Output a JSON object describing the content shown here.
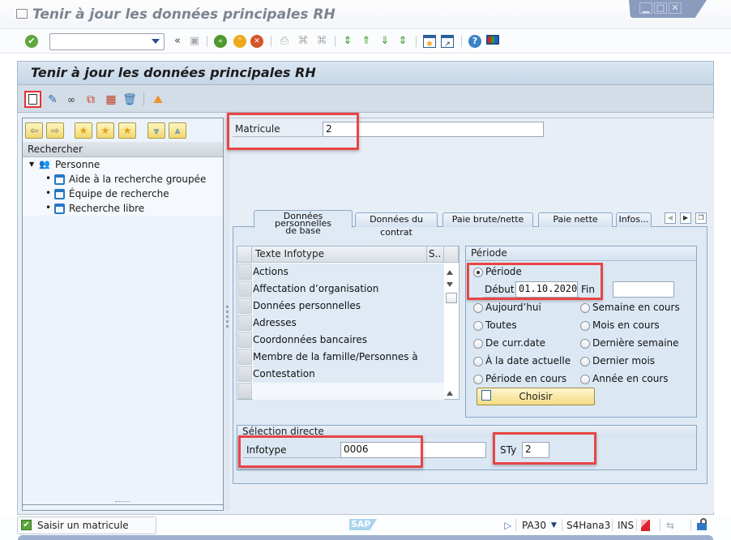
{
  "window": {
    "title": "Tenir à jour les données principales RH",
    "controls": {
      "minimize": "▁",
      "maximize": "□",
      "close": "✕"
    }
  },
  "toolbar": {
    "command_field_value": "",
    "icons": [
      "enter-icon",
      "back-arrows-icon",
      "save-icon",
      "back-icon",
      "exit-icon",
      "cancel-icon",
      "print-icon",
      "find-icon",
      "find-next-icon",
      "first-page-icon",
      "previous-page-icon",
      "next-page-icon",
      "last-page-icon",
      "create-session-icon",
      "shortcut-icon",
      "help-icon",
      "customize-layout-icon"
    ]
  },
  "header": {
    "title": "Tenir à jour les données principales RH"
  },
  "app_toolbar": {
    "icons": [
      "create-icon",
      "change-icon",
      "display-icon",
      "copy-icon",
      "overview-icon",
      "delete-icon",
      "picture-icon"
    ]
  },
  "nav_panel": {
    "search_header": "Rechercher",
    "tree": {
      "root": "Personne",
      "children": [
        "Aide à la recherche groupée",
        "Équipe de recherche",
        "Recherche libre"
      ]
    }
  },
  "matricule": {
    "label": "Matricule",
    "value": "2"
  },
  "tabs": [
    {
      "label": "Données personnelles de base",
      "line1": "Données personnelles",
      "line2": "de base",
      "active": true
    },
    {
      "label": "Données du contrat",
      "active": false
    },
    {
      "label": "Paie brute/nette",
      "active": false
    },
    {
      "label": "Paie nette",
      "active": false
    },
    {
      "label": "Infos...",
      "active": false
    }
  ],
  "infotype_table": {
    "columns": [
      "Texte Infotype",
      "S.."
    ],
    "rows": [
      "Actions",
      "Affectation d’organisation",
      "Données personnelles",
      "Adresses",
      "Coordonnées bancaires",
      "Membre de la famille/Personnes à charge",
      "Contestation",
      "",
      ""
    ]
  },
  "period": {
    "title": "Période",
    "selected_option": "Période",
    "periode_label": "Période",
    "debut_label": "Début",
    "debut_value": "01.10.2020",
    "fin_label": "Fin",
    "fin_value": "",
    "options_left": [
      "Aujourd’hui",
      "Toutes",
      "De curr.date",
      "À la date actuelle",
      "Période en cours"
    ],
    "options_right": [
      "Semaine en cours",
      "Mois en cours",
      "Dernière semaine",
      "Dernier mois",
      "Année en cours"
    ],
    "choose_button": "Choisir"
  },
  "direct_selection": {
    "title": "Sélection directe",
    "infotype_label": "Infotype",
    "infotype_value": "0006",
    "subtype_label": "STy",
    "subtype_value": "2"
  },
  "status_bar": {
    "message": "Saisir un matricule",
    "logo": "SAP",
    "transaction": "PA30",
    "system": "S4Hana3",
    "mode": "INS"
  },
  "colors": {
    "highlight": "#e84545",
    "accent_button": "#f3dc82",
    "panel_bg": "#dbe8f4"
  }
}
